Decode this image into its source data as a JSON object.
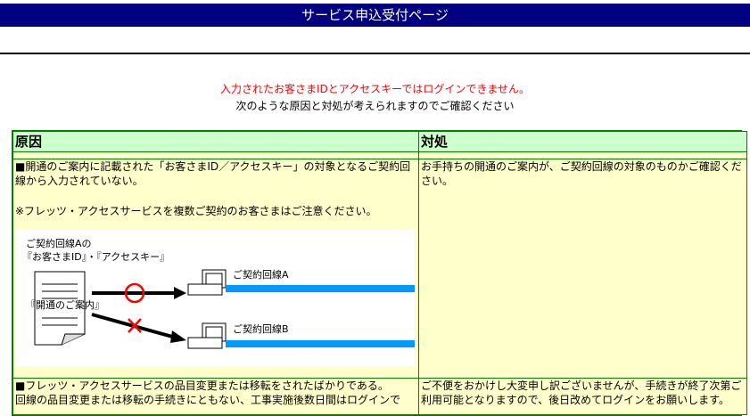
{
  "header": {
    "title": "サービス申込受付ページ"
  },
  "messages": {
    "error": "入力されたお客さまIDとアクセスキーではログインできません。",
    "info": "次のような原因と対処が考えられますのでご確認ください"
  },
  "table": {
    "col_cause": "原因",
    "col_action": "対処",
    "rows": [
      {
        "cause": "■開通のご案内に記載された「お客さまID／アクセスキー」の対象となるご契約回線から入力されていない。",
        "cause_note": "※フレッツ・アクセスサービスを複数ご契約のお客さまはご注意ください。",
        "action": "お手持ちの開通のご案内が、ご契約回線の対象のものかご確認ください。"
      },
      {
        "cause": "■フレッツ・アクセスサービスの品目変更または移転をされたばかりである。\n回線の品目変更または移転の手続きにともない、工事実施後数日間はログインで",
        "action": "ご不便をおかけし大変申し訳ございませんが、手続きが終了次第ご利用可能となりますので、後日改めてログインをお願いします。"
      }
    ]
  },
  "diagram": {
    "label_top_line1": "ご契約回線Aの",
    "label_top_line2": "『お客さまID』・『アクセスキー』",
    "doc_label": "『開通のご案内』",
    "line_a": "ご契約回線A",
    "line_b": "ご契約回線B",
    "colors": {
      "line": "#0099ff",
      "ok": "#ff0000",
      "ng": "#ff0000"
    }
  }
}
